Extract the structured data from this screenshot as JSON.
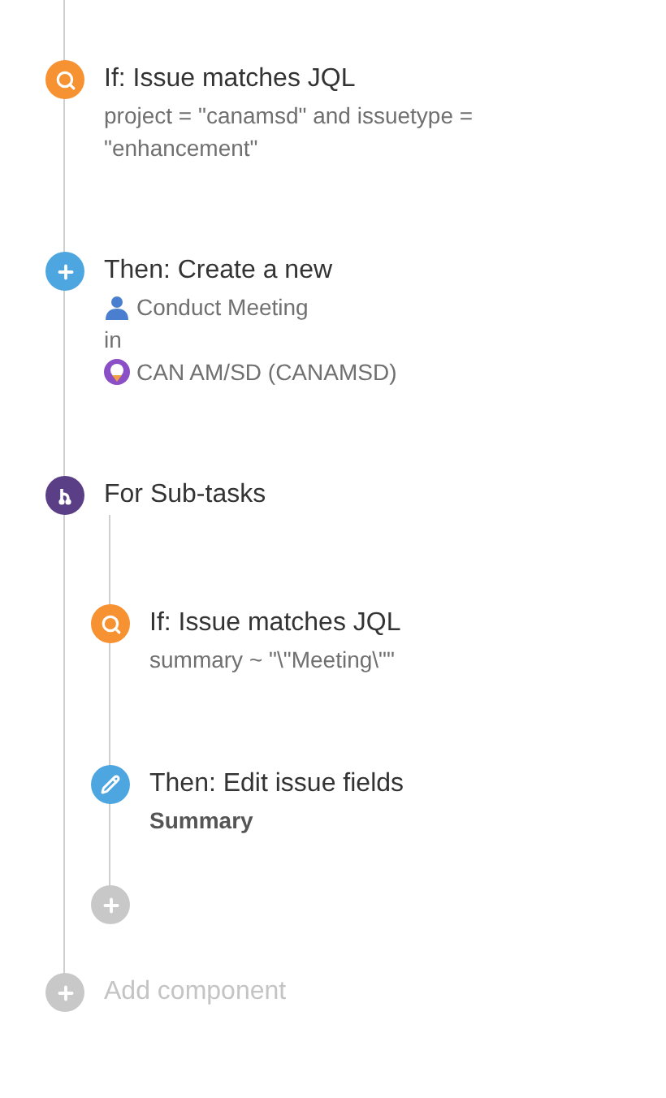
{
  "components": [
    {
      "kind": "condition",
      "title": "If: Issue matches JQL",
      "details": [
        {
          "kind": "text",
          "text": "project = \"canamsd\" and issuetype = \"enhancement\""
        }
      ]
    },
    {
      "kind": "action",
      "title": "Then: Create a new",
      "details": [
        {
          "kind": "issue-type",
          "text": "Conduct Meeting"
        },
        {
          "kind": "text",
          "text": "in"
        },
        {
          "kind": "project",
          "text": "CAN AM/SD (CANAMSD)"
        }
      ]
    },
    {
      "kind": "branch",
      "title": "For Sub-tasks",
      "children": [
        {
          "kind": "condition",
          "title": "If: Issue matches JQL",
          "details": [
            {
              "kind": "text",
              "text": "summary ~ \"\\\"Meeting\\\"\""
            }
          ]
        },
        {
          "kind": "edit",
          "title": "Then: Edit issue fields",
          "details": [
            {
              "kind": "field",
              "text": "Summary"
            }
          ]
        },
        {
          "kind": "add"
        }
      ]
    },
    {
      "kind": "add",
      "title": "Add component"
    }
  ]
}
